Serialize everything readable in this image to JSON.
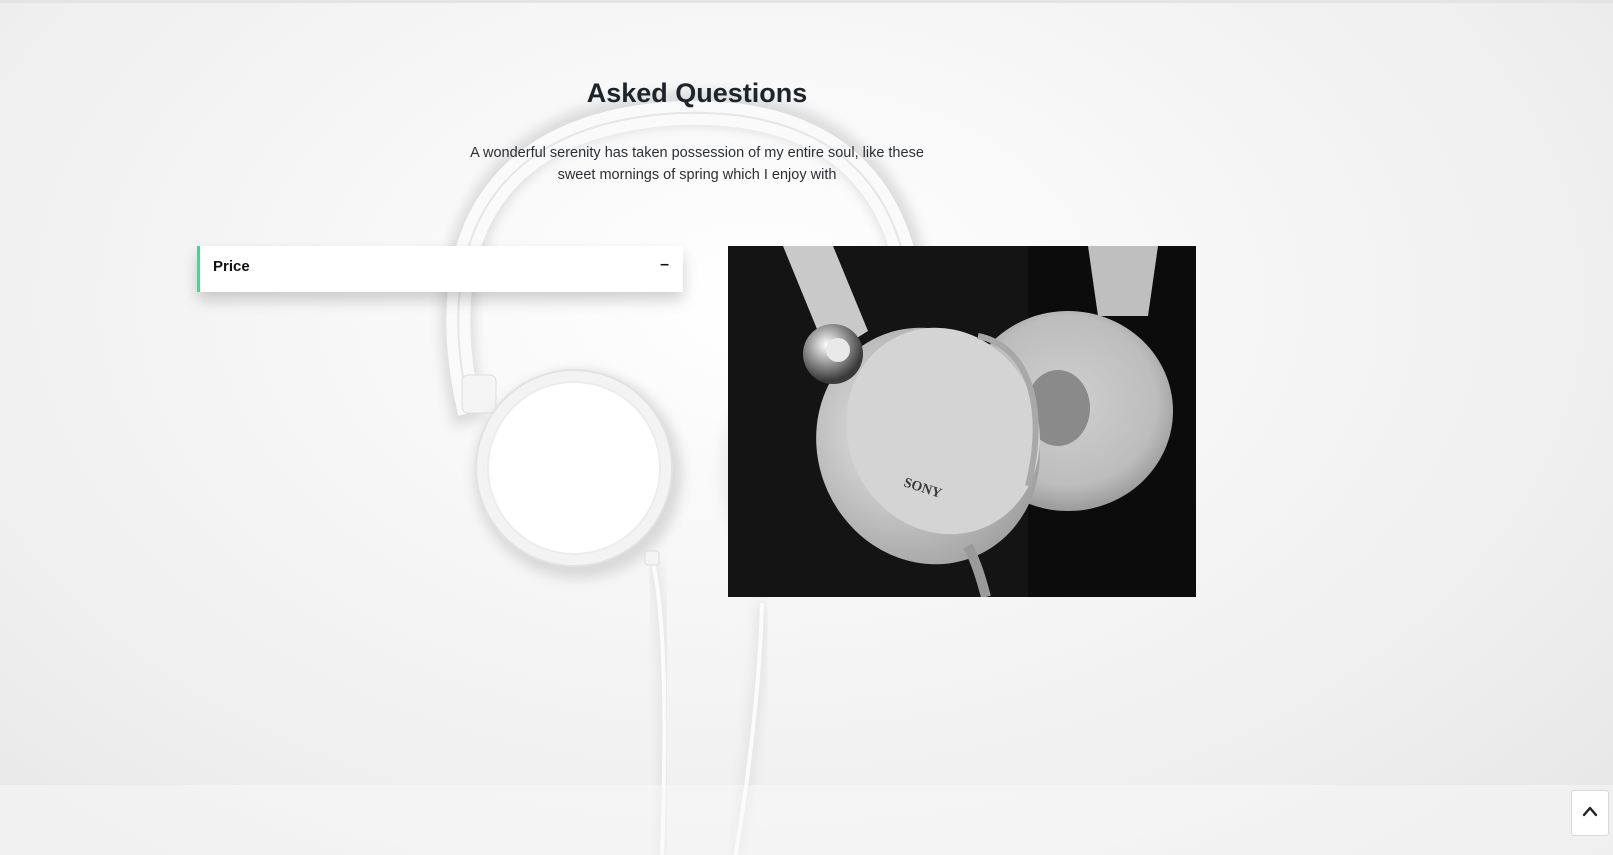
{
  "faq": {
    "title": "Asked Questions",
    "description": "A wonderful serenity has taken possession of my entire soul, like these sweet mornings of spring which I enjoy with"
  },
  "accordion": {
    "items": [
      {
        "label": "Price",
        "toggle": "–"
      }
    ]
  },
  "photo": {
    "brand_text": "SONY"
  },
  "colors": {
    "accent": "#2ee38a",
    "heading": "#1f242a"
  },
  "icons": {
    "scroll_top": "chevron-up-icon",
    "accordion_toggle": "minus-icon"
  }
}
